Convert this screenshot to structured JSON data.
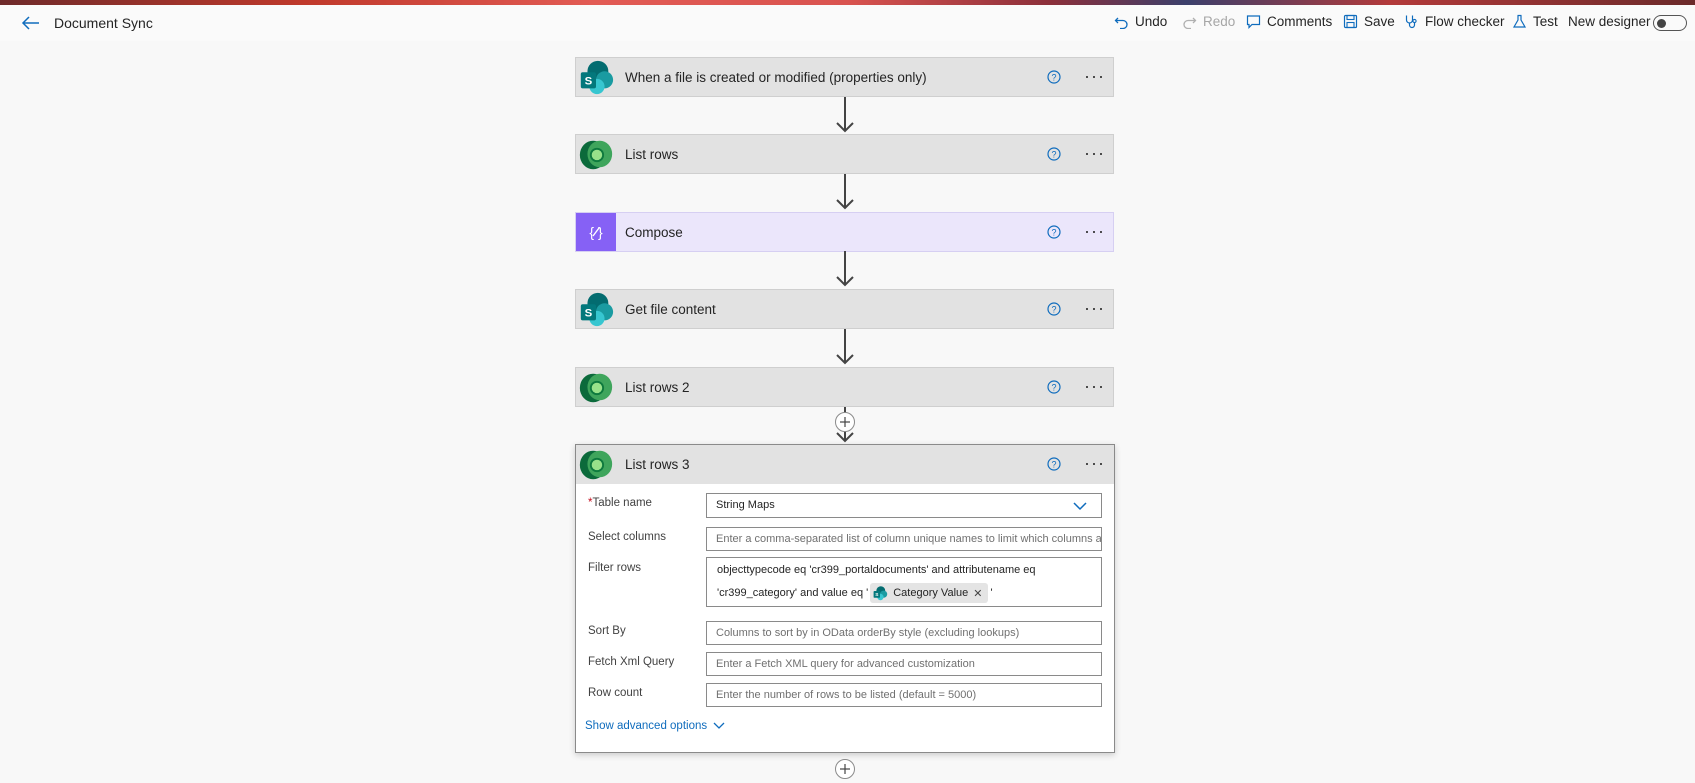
{
  "header": {
    "title": "Document Sync",
    "undo": "Undo",
    "redo": "Redo",
    "comments": "Comments",
    "save": "Save",
    "flow_checker": "Flow checker",
    "test": "Test",
    "new_designer": "New designer"
  },
  "steps": [
    {
      "label": "When a file is created or modified (properties only)",
      "connector": "sharepoint"
    },
    {
      "label": "List rows",
      "connector": "dataverse"
    },
    {
      "label": "Compose",
      "connector": "data-operation"
    },
    {
      "label": "Get file content",
      "connector": "sharepoint"
    },
    {
      "label": "List rows 2",
      "connector": "dataverse"
    }
  ],
  "expanded_step": {
    "label": "List rows 3",
    "fields": {
      "table_name": {
        "label": "Table name",
        "value": "String Maps"
      },
      "select_columns": {
        "label": "Select columns",
        "placeholder": "Enter a comma-separated list of column unique names to limit which columns a"
      },
      "filter_rows": {
        "label": "Filter rows",
        "line1": "objecttypecode eq 'cr399_portaldocuments' and attributename eq",
        "line2": "'cr399_category' and value eq '",
        "token": "Category Value",
        "suffix": "'"
      },
      "sort_by": {
        "label": "Sort By",
        "placeholder": "Columns to sort by in OData orderBy style (excluding lookups)"
      },
      "fetch_xml": {
        "label": "Fetch Xml Query",
        "placeholder": "Enter a Fetch XML query for advanced customization"
      },
      "row_count": {
        "label": "Row count",
        "placeholder": "Enter the number of rows to be listed (default = 5000)"
      }
    },
    "advanced": "Show advanced options"
  },
  "colors": {
    "accent": "#0f6cbd",
    "required": "#c50f1f",
    "compose": "#8661f5",
    "dataverse": "#0b6a3b",
    "sharepoint": "#038387"
  }
}
